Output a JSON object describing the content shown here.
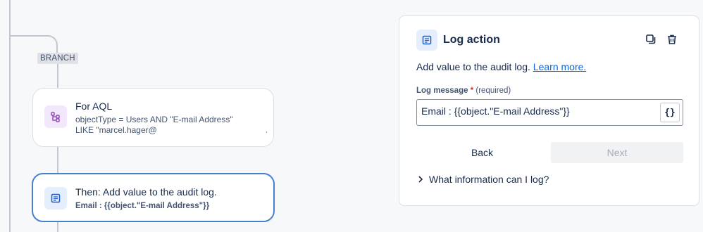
{
  "canvas": {
    "branch_tag": "BRANCH",
    "aql_node": {
      "title": "For AQL",
      "line1": "objectType = Users AND \"E-mail Address\"",
      "line2": "LIKE \"marcel.hager@",
      "tick": "ˎ",
      "icon": "branch-icon"
    },
    "log_node": {
      "title": "Then: Add value to the audit log.",
      "subtitle": "Email : {{object.\"E-mail Address\"}}",
      "icon": "log-document-icon"
    }
  },
  "panel": {
    "title": "Log action",
    "description": "Add value to the audit log.",
    "learn_more": "Learn more.",
    "field": {
      "label": "Log message",
      "required_mark": "*",
      "required_text": "(required)",
      "value": "Email : {{object.\"E-mail Address\"}}",
      "brace_button": "{}"
    },
    "back_label": "Back",
    "next_label": "Next",
    "expander_label": "What information can I log?"
  },
  "colors": {
    "accent": "#0c66e4",
    "selected_border": "#4a7fd0",
    "branch_icon_bg": "#f3e8fb",
    "log_icon_bg": "#e5eefc"
  }
}
